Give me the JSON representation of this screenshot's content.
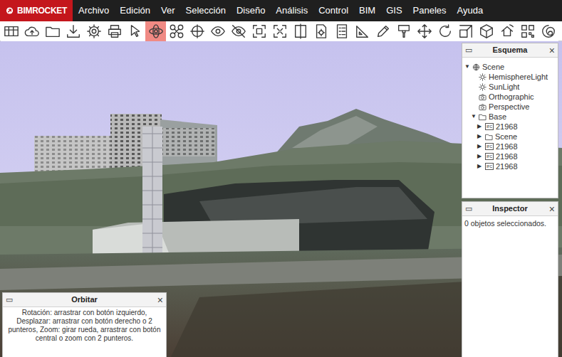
{
  "app": {
    "logo": "BIMROCKET"
  },
  "menu": [
    "Archivo",
    "Edición",
    "Ver",
    "Selección",
    "Diseño",
    "Análisis",
    "Control",
    "BIM",
    "GIS",
    "Paneles",
    "Ayuda"
  ],
  "toolbar": [
    {
      "kind": "layout",
      "selected": false
    },
    {
      "kind": "cloud",
      "selected": false
    },
    {
      "kind": "folder",
      "selected": false
    },
    {
      "kind": "download",
      "selected": false
    },
    {
      "kind": "gear",
      "selected": false
    },
    {
      "kind": "printer",
      "selected": false
    },
    {
      "kind": "pointer",
      "selected": false
    },
    {
      "kind": "orbit",
      "selected": true
    },
    {
      "kind": "drone",
      "selected": false
    },
    {
      "kind": "target",
      "selected": false
    },
    {
      "kind": "eye",
      "selected": false
    },
    {
      "kind": "eyeoff",
      "selected": false
    },
    {
      "kind": "focus",
      "selected": false
    },
    {
      "kind": "fit",
      "selected": false
    },
    {
      "kind": "section",
      "selected": false
    },
    {
      "kind": "docgear",
      "selected": false
    },
    {
      "kind": "checklist",
      "selected": false
    },
    {
      "kind": "ruler",
      "selected": false
    },
    {
      "kind": "pencil",
      "selected": false
    },
    {
      "kind": "brush",
      "selected": false
    },
    {
      "kind": "move",
      "selected": false
    },
    {
      "kind": "rotate",
      "selected": false
    },
    {
      "kind": "scale",
      "selected": false
    },
    {
      "kind": "cube",
      "selected": false
    },
    {
      "kind": "home",
      "selected": false
    },
    {
      "kind": "qr",
      "selected": false
    },
    {
      "kind": "swirl",
      "selected": false
    }
  ],
  "outline": {
    "title": "Esquema",
    "minimize": "▭",
    "close": "×",
    "tree": [
      {
        "label": "Scene",
        "kind": "scene",
        "toggle": "▼",
        "expanded": true,
        "children": [
          {
            "label": "HemisphereLight",
            "kind": "light"
          },
          {
            "label": "SunLight",
            "kind": "light"
          },
          {
            "label": "Orthographic",
            "kind": "camera"
          },
          {
            "label": "Perspective",
            "kind": "camera"
          },
          {
            "label": "Base",
            "kind": "folder",
            "toggle": "▼",
            "expanded": true,
            "children": [
              {
                "label": "21968",
                "kind": "ifc",
                "badge": "IFC",
                "toggle": "▶",
                "expanded": false
              },
              {
                "label": "Scene",
                "kind": "folder",
                "toggle": "▶",
                "expanded": false
              },
              {
                "label": "21968",
                "kind": "ifc",
                "badge": "IFC",
                "toggle": "▶",
                "expanded": false
              },
              {
                "label": "21968",
                "kind": "ifc",
                "badge": "IFC",
                "toggle": "▶",
                "expanded": false
              },
              {
                "label": "21968",
                "kind": "ifc",
                "badge": "IFC",
                "toggle": "▶",
                "expanded": false
              }
            ]
          }
        ]
      }
    ]
  },
  "inspector": {
    "title": "Inspector",
    "minimize": "▭",
    "close": "×",
    "message": "0 objetos seleccionados."
  },
  "orbit_panel": {
    "title": "Orbitar",
    "minimize": "▭",
    "close": "×",
    "help": "Rotación: arrastrar con botón izquierdo, Desplazar: arrastrar con botón derecho o 2 punteros, Zoom: girar rueda, arrastrar con botón central o zoom con 2 punteros."
  }
}
